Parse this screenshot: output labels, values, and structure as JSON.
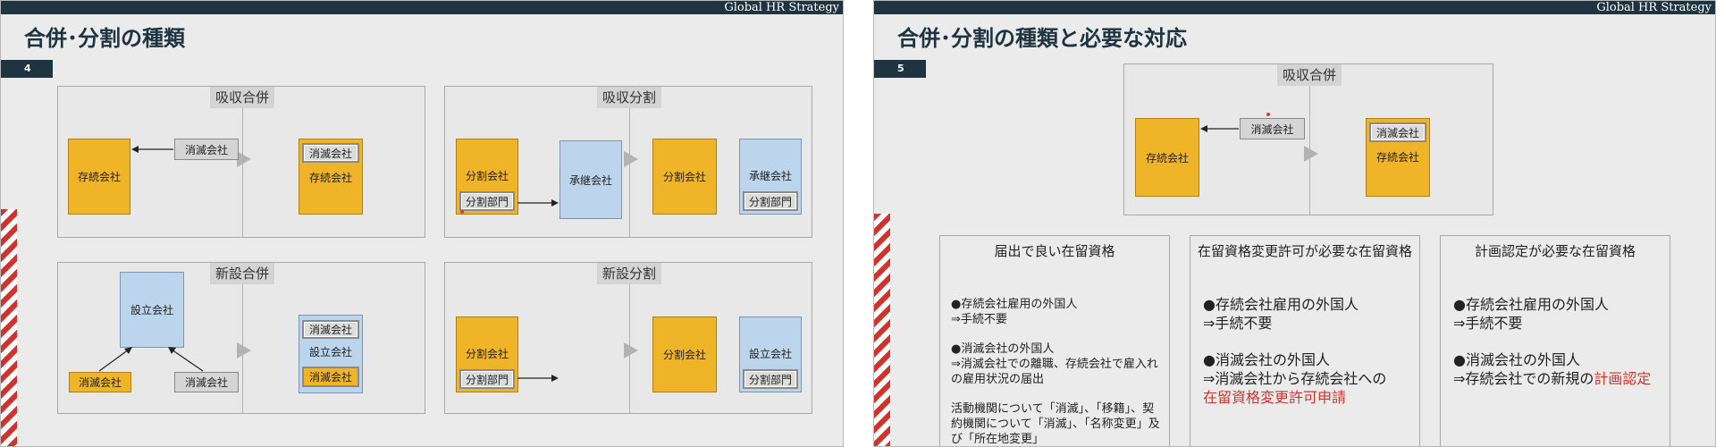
{
  "brand": "Global HR Strategy",
  "slide_left": {
    "title": "合併･分割の種類",
    "page_no": "4",
    "panels": {
      "absorb_merge": {
        "title": "吸収合併",
        "before_survivor": "存続会社",
        "before_dissolved": "消滅会社",
        "after_top": "消滅会社",
        "after_label": "存続会社"
      },
      "absorb_split": {
        "title": "吸収分割",
        "split_company": "分割会社",
        "split_dept": "分割部門",
        "successor": "承継会社",
        "after_split_company": "分割会社",
        "after_successor": "承継会社",
        "after_dept": "分割部門"
      },
      "new_merge": {
        "title": "新設合併",
        "established": "設立会社",
        "dissolved_a": "消滅会社",
        "dissolved_b": "消滅会社",
        "after_top": "消滅会社",
        "after_mid": "設立会社",
        "after_bottom": "消滅会社"
      },
      "new_split": {
        "title": "新設分割",
        "split_company": "分割会社",
        "split_dept": "分割部門",
        "after_split_company": "分割会社",
        "after_established": "設立会社",
        "after_dept": "分割部門"
      }
    }
  },
  "slide_right": {
    "title": "合併･分割の種類と必要な対応",
    "page_no": "5",
    "diagram": {
      "title": "吸収合併",
      "survivor": "存続会社",
      "dissolved": "消滅会社",
      "after_top": "消滅会社",
      "after_label": "存続会社"
    },
    "columns": [
      {
        "title": "届出で良い在留資格",
        "item1": "●存続会社雇用の外国人\n⇒手続不要",
        "item2": "●消滅会社の外国人\n⇒消滅会社での離職、存続会社で雇入れの雇用状況の届出",
        "item3": "活動機関について「消滅」、「移籍」、契約機関について「消滅」、「名称変更」及び「所在地変更」"
      },
      {
        "title": "在留資格変更許可が必要な在留資格",
        "item1": "●存続会社雇用の外国人\n⇒手続不要",
        "item2_a": "●消滅会社の外国人\n⇒消滅会社から存続会社への",
        "item2_red": "在留資格変更許可申請"
      },
      {
        "title": "計画認定が必要な在留資格",
        "item1": "●存続会社雇用の外国人\n⇒手続不要",
        "item2_a": "●消滅会社の外国人\n⇒存続会社での新規の",
        "item2_red": "計画認定"
      }
    ]
  },
  "colors": {
    "navy": "#1e3440",
    "orange": "#f0b429",
    "blue": "#bcd4ec",
    "gray": "#d5d5d5",
    "accent_red": "#d1322b"
  }
}
